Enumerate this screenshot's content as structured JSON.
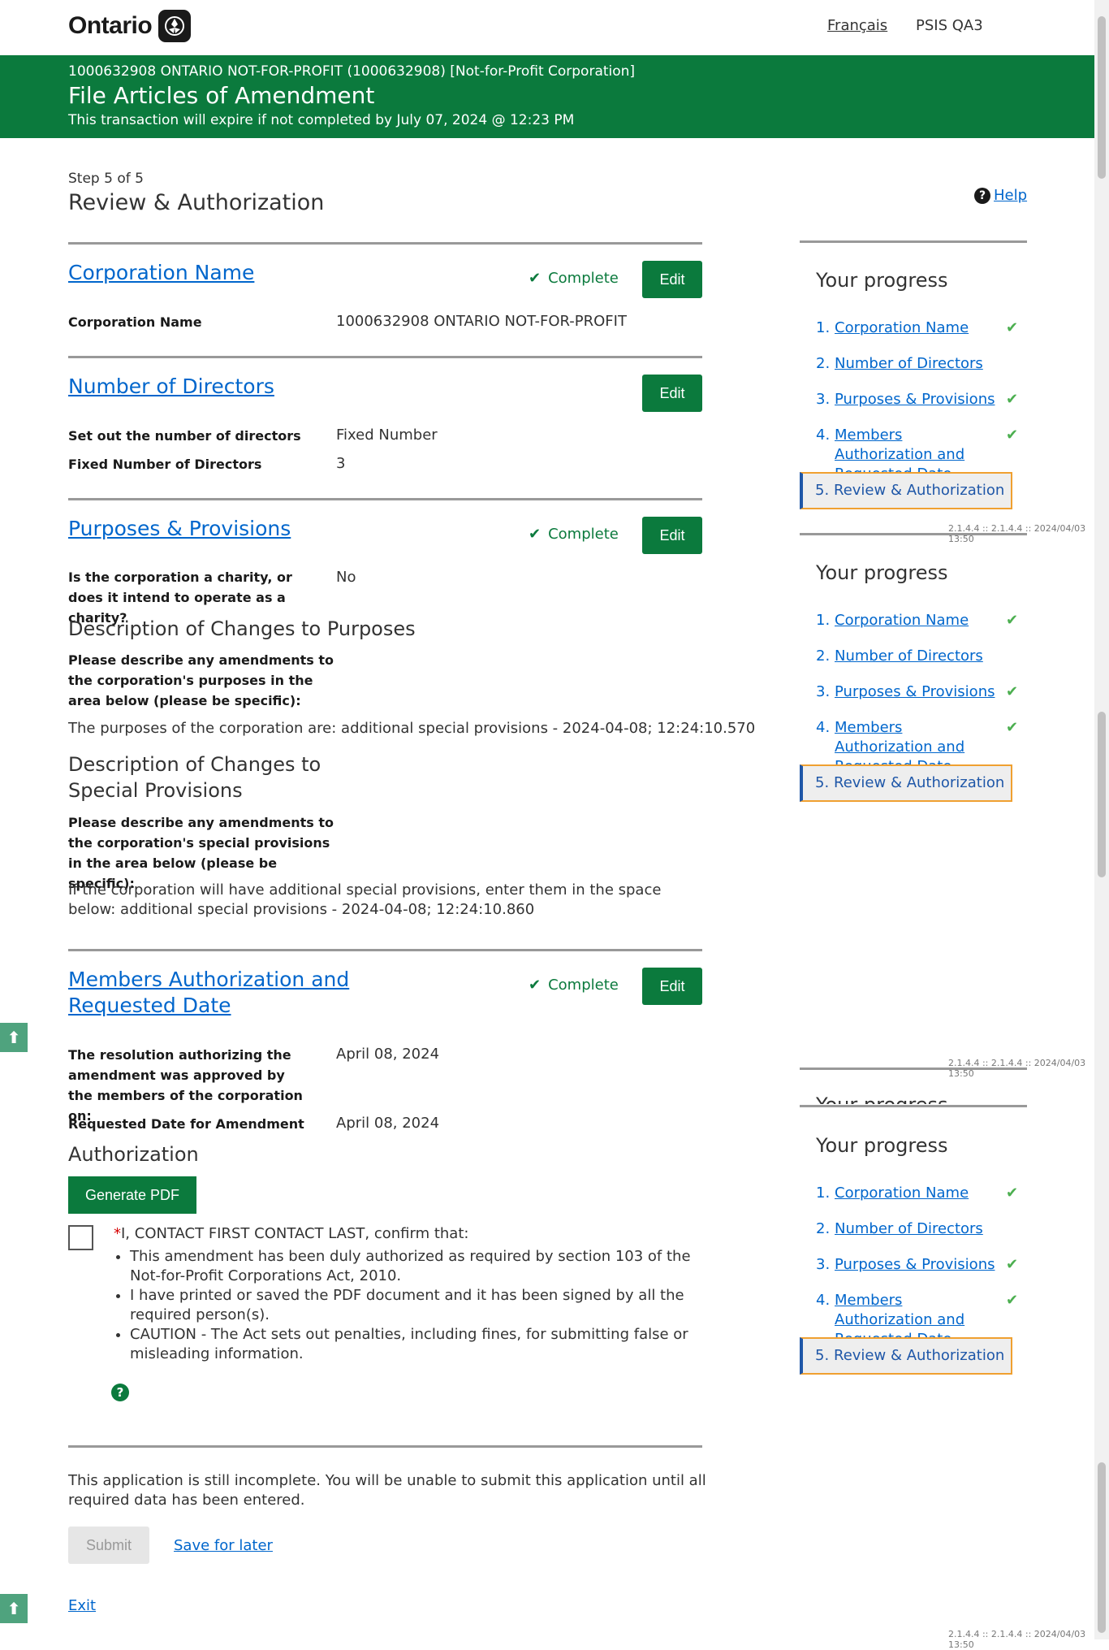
{
  "header": {
    "logo_text": "Ontario",
    "french_link": "Français",
    "environment": "PSIS QA3"
  },
  "banner": {
    "corporation": "1000632908 ONTARIO NOT-FOR-PROFIT (1000632908) [Not-for-Profit Corporation]",
    "title": "File Articles of Amendment",
    "expiry": "This transaction will expire if not completed by July 07, 2024 @ 12:23 PM"
  },
  "page": {
    "step": "Step 5 of 5",
    "title": "Review & Authorization",
    "help": "Help"
  },
  "common": {
    "complete": "Complete",
    "edit": "Edit"
  },
  "corp_name_section": {
    "title": "Corporation Name",
    "label": "Corporation Name",
    "value": "1000632908 ONTARIO NOT-FOR-PROFIT"
  },
  "directors_section": {
    "title": "Number of Directors",
    "label1": "Set out the number of directors",
    "value1": "Fixed Number",
    "label2": "Fixed Number of Directors",
    "value2": "3"
  },
  "purposes_section": {
    "title": "Purposes & Provisions",
    "charity_label": "Is the corporation a charity, or does it intend to operate as a charity?",
    "charity_value": "No",
    "purposes_heading": "Description of Changes to Purposes",
    "purposes_label": "Please describe any amendments to the corporation's purposes in the area below (please be specific):",
    "purposes_text": "The purposes of the corporation are: additional special provisions - 2024-04-08; 12:24:10.570",
    "provisions_heading": "Description of Changes to Special Provisions",
    "provisions_label": "Please describe any amendments to the corporation's special provisions in the area below (please be specific):",
    "provisions_text": "If the corporation will have additional special provisions, enter them in the space below: additional special provisions - 2024-04-08; 12:24:10.860"
  },
  "members_section": {
    "title": "Members Authorization and Requested Date",
    "resolution_label": "The resolution authorizing the amendment was approved by the members of the corporation on:",
    "resolution_value": "April 08, 2024",
    "requested_label": "Requested Date for Amendment",
    "requested_value": "April 08, 2024"
  },
  "authorization": {
    "heading": "Authorization",
    "generate_pdf": "Generate PDF",
    "required_mark": "*",
    "confirm": "I, CONTACT FIRST CONTACT LAST, confirm that:",
    "bullets": [
      "This amendment has been duly authorized as required by section 103 of the Not-for-Profit Corporations Act, 2010.",
      "I have printed or saved the PDF document and it has been signed by all the required person(s).",
      "CAUTION - The Act sets out penalties, including fines, for submitting false or misleading information."
    ]
  },
  "footer": {
    "incomplete": "This application is still incomplete. You will be unable to submit this application until all required data has been entered.",
    "submit": "Submit",
    "save_later": "Save for later",
    "exit": "Exit"
  },
  "progress": {
    "title": "Your progress",
    "ghost_title": "Your progress",
    "items": [
      {
        "num": "1.",
        "label": "Corporation Name",
        "complete": true
      },
      {
        "num": "2.",
        "label": "Number of Directors",
        "complete": false
      },
      {
        "num": "3.",
        "label": "Purposes & Provisions",
        "complete": true
      },
      {
        "num": "4.",
        "label": "Members Authorization and Requested Date",
        "complete": true
      }
    ],
    "current": {
      "num": "5.",
      "label": "Review & Authorization"
    },
    "version": "2.1.4.4 :: 2.1.4.4 :: 2024/04/03 13:50"
  },
  "icons": {
    "check": "check-icon",
    "help": "question-circle-icon",
    "back_to_top": "arrow-up-icon"
  },
  "colors": {
    "brand_green": "#0b7a3d",
    "link_blue": "#0066cc",
    "check_green": "#4caf50",
    "current_border": "#f0a030"
  }
}
